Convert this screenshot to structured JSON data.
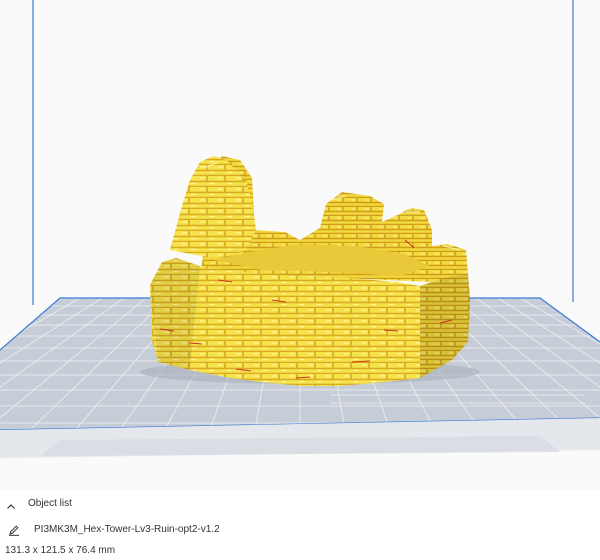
{
  "object_list": {
    "toggle_label": "Object list",
    "file_name": "PI3MK3M_Hex-Tower-Lv3-Ruin-opt2-v1.2",
    "dimensions": "131.3 x 121.5 x 76.4 mm"
  },
  "icons": {
    "toggle": "chevron-up-icon",
    "edit": "pencil-icon"
  },
  "colors": {
    "build_volume_edge": "#3b7bd6",
    "build_plate": "#c7cdd7",
    "grid_line": "#eef0f4",
    "model": "#f6e24a",
    "model_shadow": "#e0b52a",
    "model_highlight": "#fff59b",
    "model_crack": "#c8191f"
  }
}
